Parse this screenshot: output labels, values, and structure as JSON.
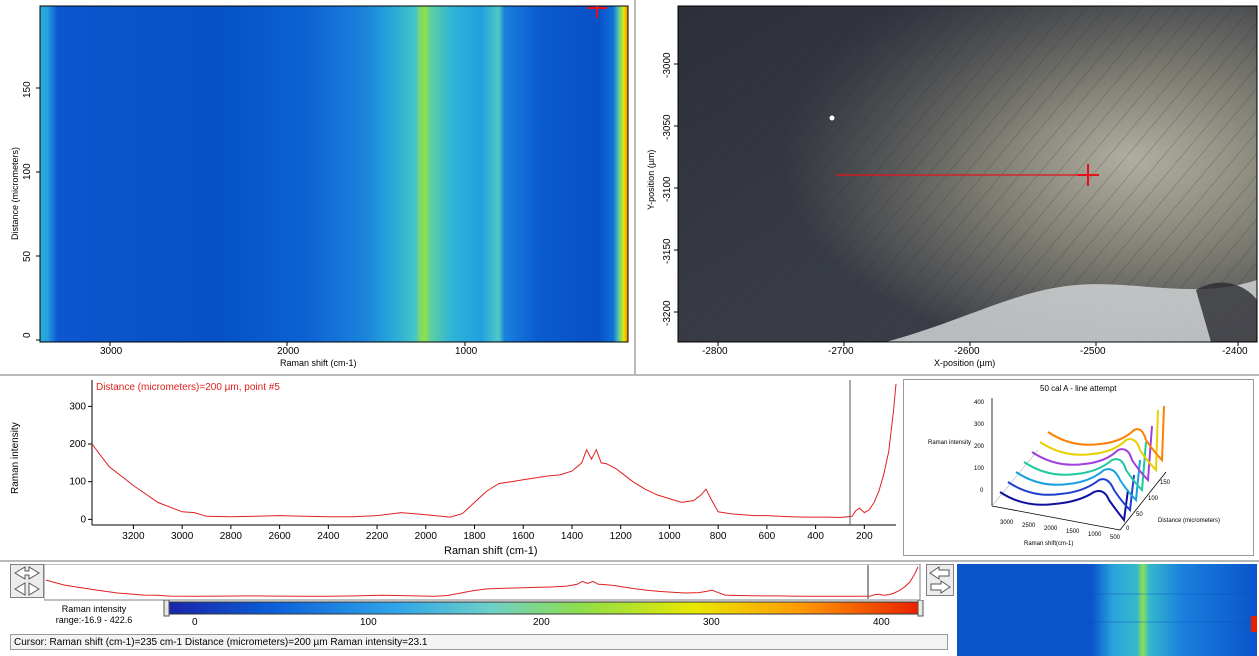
{
  "colors": {
    "colormap": [
      "#1a24a8",
      "#0b5fd8",
      "#2fa4e8",
      "#6fd0c8",
      "#8ede4a",
      "#e8e800",
      "#ff9a00",
      "#e82000"
    ],
    "spectrum": "#e02020",
    "cursor": "#e8101a",
    "axis": "#000000"
  },
  "heatmap": {
    "xlabel": "Raman shift (cm-1)",
    "ylabel": "Distance (micrometers)",
    "xticks": [
      "3000",
      "2000",
      "1000"
    ],
    "yticks": [
      "0",
      "50",
      "100",
      "150"
    ]
  },
  "image_view": {
    "xlabel": "X-position (µm)",
    "ylabel": "Y-position (µm)",
    "xticks": [
      "-2800",
      "-2700",
      "-2600",
      "-2500",
      "-2400"
    ],
    "yticks": [
      "-3000",
      "-3050",
      "-3100",
      "-3150",
      "-3200"
    ]
  },
  "spectrum_plot": {
    "annotation": "Distance (micrometers)=200 µm, point #5",
    "xlabel": "Raman shift (cm-1)",
    "ylabel": "Raman intensity",
    "xticks": [
      "3200",
      "3000",
      "2800",
      "2600",
      "2400",
      "2200",
      "2000",
      "1800",
      "1600",
      "1400",
      "1200",
      "1000",
      "800",
      "600",
      "400",
      "200"
    ],
    "yticks": [
      "0",
      "100",
      "200",
      "300"
    ]
  },
  "waterfall": {
    "title": "50 cal A - line attempt",
    "ylabel": "Raman intensity",
    "xlabel": "Raman shift(cm-1)",
    "zlabel": "Distance (micrometers)",
    "yticks": [
      "0",
      "100",
      "200",
      "300",
      "400"
    ],
    "xticks": [
      "3000",
      "2500",
      "2000",
      "1500",
      "1000",
      "500"
    ],
    "zticks": [
      "0",
      "50",
      "100",
      "150"
    ]
  },
  "colorbar": {
    "range_label": "Raman intensity range:-16.9 - 422.6",
    "ticks": [
      "0",
      "100",
      "200",
      "300",
      "400"
    ]
  },
  "status": {
    "text": "Cursor: Raman shift (cm-1)=235 cm-1  Distance (micrometers)=200 µm  Raman intensity=23.1"
  },
  "chart_data": {
    "type": "line",
    "title": "",
    "annotation": "Distance (micrometers)=200 µm, point #5",
    "xlabel": "Raman shift (cm-1)",
    "ylabel": "Raman intensity",
    "xlim": [
      3370,
      70
    ],
    "ylim": [
      -15,
      370
    ],
    "x": [
      3370,
      3300,
      3200,
      3100,
      3000,
      2950,
      2900,
      2800,
      2700,
      2600,
      2500,
      2400,
      2300,
      2200,
      2100,
      2000,
      1900,
      1850,
      1800,
      1750,
      1700,
      1650,
      1600,
      1550,
      1500,
      1450,
      1400,
      1360,
      1340,
      1320,
      1300,
      1280,
      1260,
      1220,
      1200,
      1150,
      1100,
      1050,
      1000,
      950,
      900,
      870,
      850,
      830,
      800,
      750,
      700,
      650,
      600,
      550,
      500,
      450,
      400,
      350,
      300,
      250,
      235,
      220,
      200,
      180,
      160,
      140,
      120,
      100,
      80,
      70
    ],
    "y": [
      200,
      140,
      90,
      45,
      20,
      18,
      8,
      7,
      8,
      10,
      8,
      7,
      7,
      10,
      18,
      12,
      6,
      15,
      45,
      75,
      95,
      100,
      105,
      110,
      115,
      118,
      128,
      150,
      185,
      160,
      185,
      150,
      148,
      135,
      125,
      100,
      80,
      65,
      55,
      45,
      50,
      65,
      80,
      55,
      20,
      15,
      12,
      10,
      10,
      8,
      7,
      6,
      6,
      6,
      5,
      8,
      23.1,
      30,
      18,
      25,
      45,
      75,
      120,
      180,
      290,
      360
    ]
  }
}
